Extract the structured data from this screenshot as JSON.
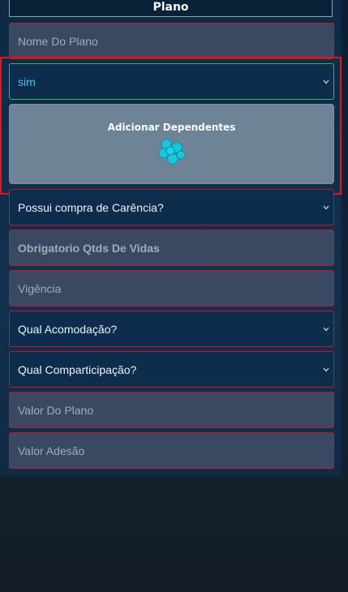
{
  "form": {
    "title": "Plano",
    "fields": {
      "plan_name_placeholder": "Nome Do Plano",
      "dependents_select_value": "sim",
      "add_dependents_label": "Adicionar Dependentes",
      "grace_purchase_select": "Possui compra de Carência?",
      "required_lives_placeholder": "Obrigatorio Qtds De Vidas",
      "validity_placeholder": "Vigência",
      "accommodation_select": "Qual Acomodação?",
      "copay_select": "Qual Comparticipação?",
      "plan_value_placeholder": "Valor Do Plano",
      "membership_value_placeholder": "Valor Adesão"
    }
  },
  "icons": {
    "chevron": "chevron-down-icon",
    "add_dependents": "users-group-icon"
  },
  "colors": {
    "field_border": "#c2172c",
    "selected_border": "#22c063",
    "selected_text": "#46c3ee",
    "highlight": "#e8111e",
    "icon_accent": "#18c6de"
  }
}
